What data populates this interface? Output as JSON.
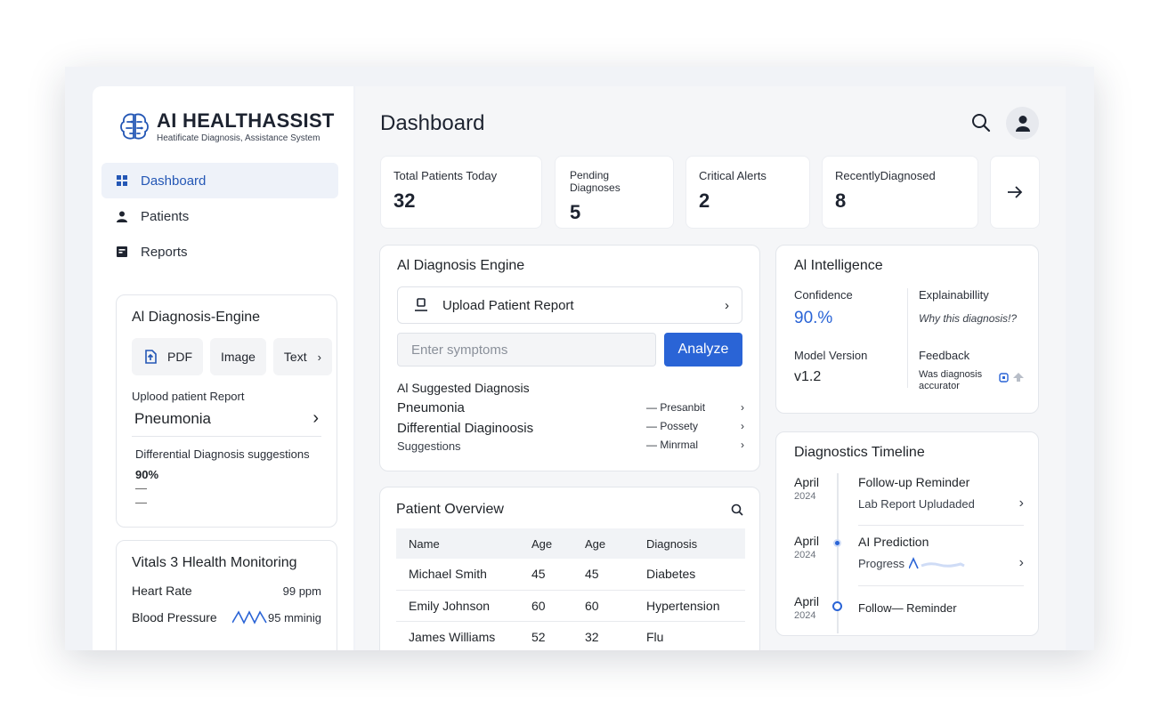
{
  "brand": {
    "title": "AI HEALTHASSIST",
    "subtitle": "Heatificate Diagnosis, Assistance System"
  },
  "nav": [
    {
      "label": "Dashboard",
      "icon": "grid-icon",
      "active": true
    },
    {
      "label": "Patients",
      "icon": "person-icon",
      "active": false
    },
    {
      "label": "Reports",
      "icon": "report-icon",
      "active": false
    }
  ],
  "sidebar_engine": {
    "title": "Al Diagnosis-Engine",
    "tabs": [
      "PDF",
      "Image",
      "Text"
    ],
    "upload_label": "Uplood patient Report",
    "diagnosis": "Pneumonia",
    "differential": "Differential Diagnosis suggestions",
    "percent": "90%",
    "dash1": "—",
    "dash2": "—"
  },
  "vitals": {
    "title": "Vitals 3 Hlealth Monitoring",
    "heart_rate_label": "Heart Rate",
    "heart_rate_value": "99  ppm",
    "bp_label": "Blood Pressure",
    "bp_value": "95 mminig"
  },
  "header": {
    "title": "Dashboard"
  },
  "stats": [
    {
      "label": "Total Patients Today",
      "value": "32"
    },
    {
      "label": "Pending Diagnoses",
      "value": "5"
    },
    {
      "label": "Critical Alerts",
      "value": "2"
    },
    {
      "label": "RecentlyDiagnosed",
      "value": "8"
    }
  ],
  "engine": {
    "title": "Al Diagnosis Engine",
    "upload": "Upload Patient Report",
    "symptoms_placeholder": "Enter symptoms",
    "analyze": "Analyze",
    "suggested_title": "Al Suggested Diagnosis",
    "line1": "Pneumonia",
    "line2": "Differential Diaginoosis",
    "line3": "Suggestions",
    "right": [
      {
        "label": "— Presanbit"
      },
      {
        "label": "— Possety"
      },
      {
        "label": "— Minrmal"
      }
    ]
  },
  "intel": {
    "title": "Al Intelligence",
    "confidence_label": "Confidence",
    "confidence_value": "90.%",
    "explain_label": "Explainabillity",
    "explain_value": "Why this diagnosis!?",
    "model_label": "Model Version",
    "model_value": "v1.2",
    "feedback_label": "Feedback",
    "feedback_value": "Was diagnosis accurator"
  },
  "timeline": {
    "title": "Diagnostics Timeline",
    "entries": [
      {
        "month": "April",
        "year": "2024",
        "title": "Follow-up Reminder",
        "sub": "Lab Report Upludaded"
      },
      {
        "month": "April",
        "year": "2024",
        "title": "AI Prediction",
        "sub": "Progress"
      },
      {
        "month": "April",
        "year": "2024",
        "title": "Follow— Reminder",
        "sub": ""
      }
    ]
  },
  "overview": {
    "title": "Patient Overview",
    "columns": [
      "Name",
      "Age",
      "Age",
      "Diagnosis"
    ],
    "rows": [
      [
        "Michael Smith",
        "45",
        "45",
        "Diabetes"
      ],
      [
        "Emily Johnson",
        "60",
        "60",
        "Hypertension"
      ],
      [
        "James Williams",
        "52",
        "32",
        "Flu"
      ]
    ]
  },
  "colors": {
    "accent": "#2a64d6",
    "active_nav_bg": "#eef2f9"
  }
}
